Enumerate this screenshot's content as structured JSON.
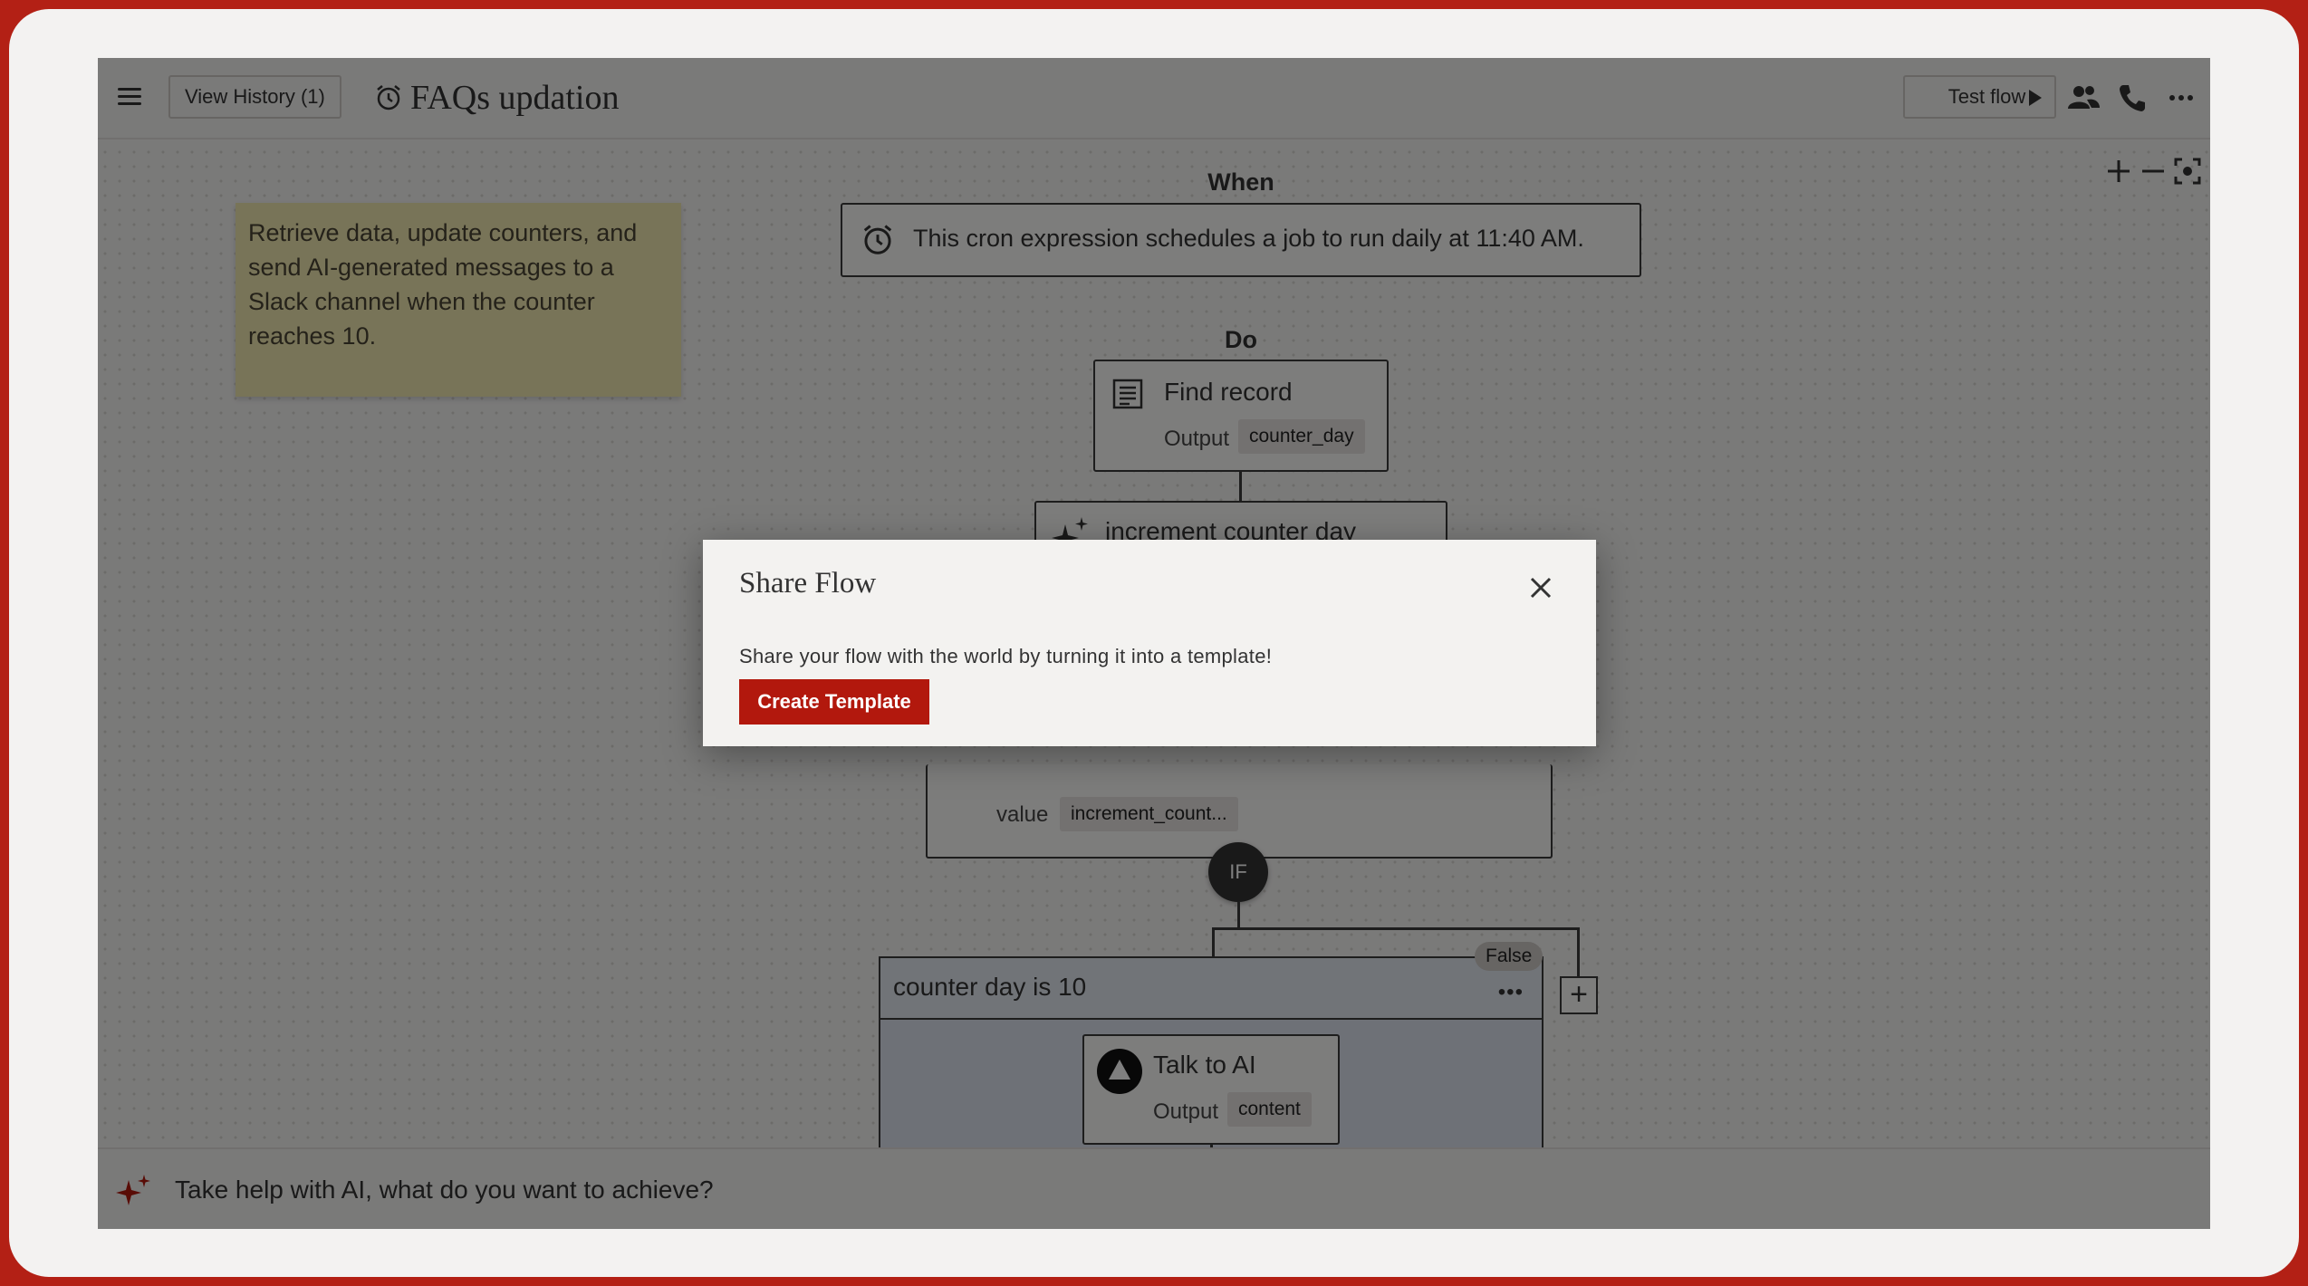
{
  "header": {
    "menu_icon": "hamburger-menu-icon",
    "history_label": "View History (1)",
    "title": "FAQs updation",
    "test_flow_label": "Test flow",
    "icons": [
      "users-icon",
      "phone-icon",
      "more-horizontal-icon"
    ]
  },
  "canvas": {
    "zoom_controls": [
      "zoom-in-icon",
      "zoom-out-icon",
      "fit-screen-icon"
    ],
    "note": "Retrieve data, update counters, and send AI-generated messages to a Slack channel when the counter reaches 10.",
    "when_label": "When",
    "trigger_text": "This cron expression schedules a job to run daily at 11:40 AM.",
    "do_label": "Do",
    "find_record": {
      "title": "Find record",
      "output_label": "Output",
      "output_value": "counter_day"
    },
    "increment_node": {
      "title": "increment counter day"
    },
    "update_node": {
      "value_label": "value",
      "value_chip": "increment_count..."
    },
    "if_label": "IF",
    "branch": {
      "title": "counter day is 10",
      "more": "•••",
      "false_badge": "False",
      "add_symbol": "+"
    },
    "talk_ai": {
      "title": "Talk to AI",
      "output_label": "Output",
      "output_value": "content"
    }
  },
  "ai_bar": {
    "placeholder": "Take help with AI, what do you want to achieve?"
  },
  "modal": {
    "title": "Share Flow",
    "description": "Share your flow with the world by turning it into a template!",
    "button_label": "Create Template"
  },
  "colors": {
    "accent": "#b2180d",
    "frame": "#b32015",
    "note": "#f1e8b0",
    "branch": "#dde3ee"
  }
}
